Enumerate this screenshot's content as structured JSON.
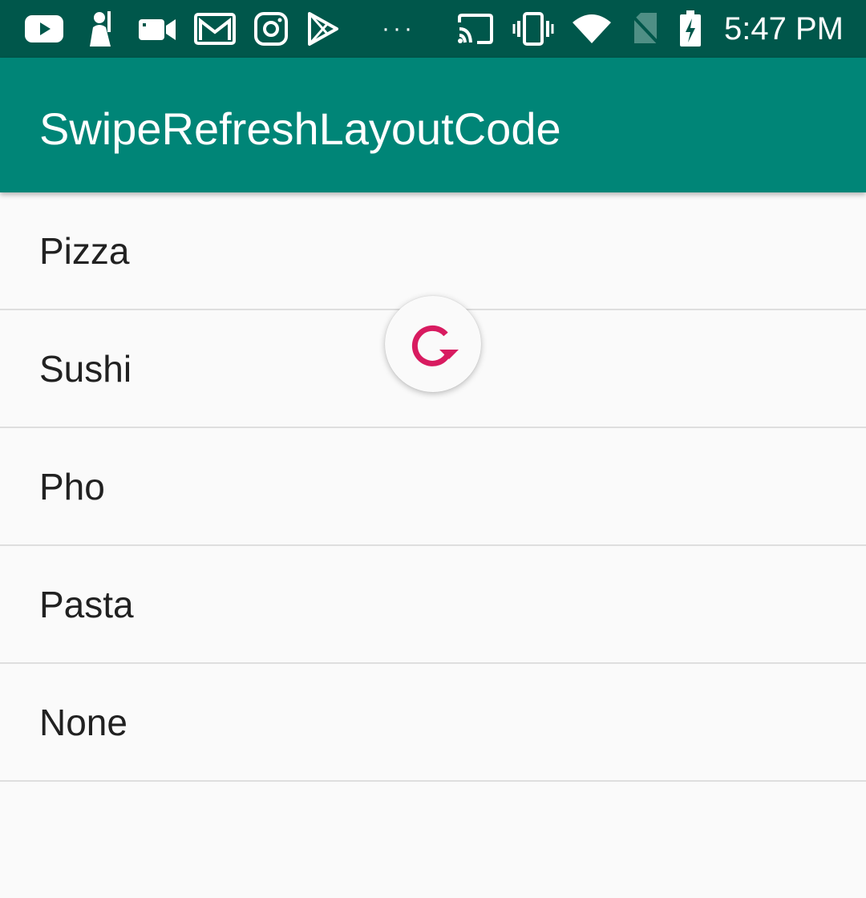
{
  "status_bar": {
    "time": "5:47 PM",
    "overflow_indicator": "···",
    "left_icons": [
      "youtube-icon",
      "game-character-icon",
      "video-camera-icon",
      "gmail-icon",
      "instagram-icon",
      "play-store-icon"
    ],
    "right_icons": [
      "cast-icon",
      "vibrate-icon",
      "wifi-icon",
      "no-sim-icon",
      "battery-charging-icon"
    ],
    "background_color": "#00574b"
  },
  "app_bar": {
    "title": "SwipeRefreshLayoutCode",
    "background_color": "#008577"
  },
  "list": {
    "items": [
      {
        "label": "Pizza"
      },
      {
        "label": "Sushi"
      },
      {
        "label": "Pho"
      },
      {
        "label": "Pasta"
      },
      {
        "label": "None"
      }
    ]
  },
  "refresh_indicator": {
    "icon": "refresh-arrow-icon",
    "color": "#d81b60"
  }
}
